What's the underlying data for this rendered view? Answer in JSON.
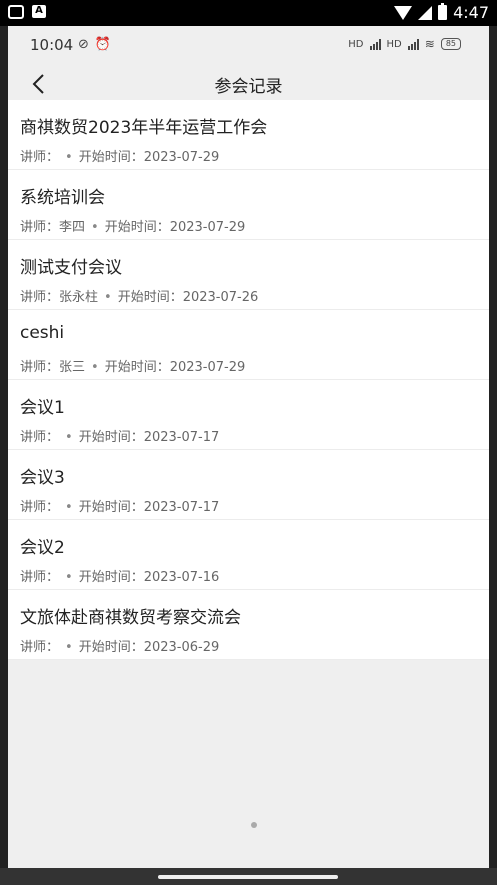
{
  "device_status": {
    "time": "4:47",
    "notification_icon_label": "A"
  },
  "app_status": {
    "time": "10:04",
    "battery": "85",
    "network": "HD"
  },
  "header": {
    "title": "参会记录"
  },
  "meetings": [
    {
      "title": "商祺数贸2023年半年运营工作会",
      "lecturer_label": "讲师：",
      "lecturer": "",
      "start_label": "开始时间：",
      "start": "2023-07-29"
    },
    {
      "title": "系统培训会",
      "lecturer_label": "讲师：",
      "lecturer": "李四",
      "start_label": "开始时间：",
      "start": "2023-07-29"
    },
    {
      "title": "测试支付会议",
      "lecturer_label": "讲师：",
      "lecturer": "张永柱",
      "start_label": "开始时间：",
      "start": "2023-07-26"
    },
    {
      "title": "ceshi",
      "lecturer_label": "讲师：",
      "lecturer": "张三",
      "start_label": "开始时间：",
      "start": "2023-07-29"
    },
    {
      "title": "会议1",
      "lecturer_label": "讲师：",
      "lecturer": "",
      "start_label": "开始时间：",
      "start": "2023-07-17"
    },
    {
      "title": "会议3",
      "lecturer_label": "讲师：",
      "lecturer": "",
      "start_label": "开始时间：",
      "start": "2023-07-17"
    },
    {
      "title": "会议2",
      "lecturer_label": "讲师：",
      "lecturer": "",
      "start_label": "开始时间：",
      "start": "2023-07-16"
    },
    {
      "title": "文旅体赴商祺数贸考察交流会",
      "lecturer_label": "讲师：",
      "lecturer": "",
      "start_label": "开始时间：",
      "start": "2023-06-29"
    }
  ],
  "separator": "•"
}
